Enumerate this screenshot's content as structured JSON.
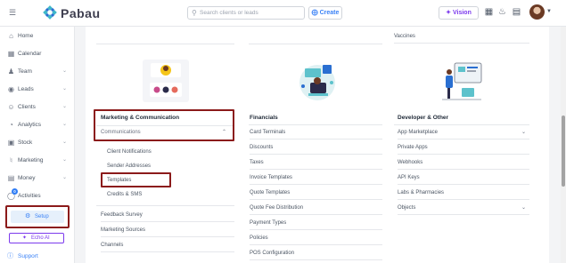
{
  "header": {
    "brand": "Pabau",
    "search_placeholder": "Search clients or leads",
    "create_label": "Create",
    "vision_label": "Vision"
  },
  "sidebar": {
    "items": [
      {
        "label": "Home",
        "icon": "home-icon",
        "caret": false
      },
      {
        "label": "Calendar",
        "icon": "calendar-icon",
        "caret": false
      },
      {
        "label": "Team",
        "icon": "team-icon",
        "caret": true
      },
      {
        "label": "Leads",
        "icon": "leads-icon",
        "caret": true
      },
      {
        "label": "Clients",
        "icon": "clients-icon",
        "caret": true
      },
      {
        "label": "Analytics",
        "icon": "analytics-icon",
        "caret": true
      },
      {
        "label": "Stock",
        "icon": "stock-icon",
        "caret": true
      },
      {
        "label": "Marketing",
        "icon": "marketing-icon",
        "caret": true
      },
      {
        "label": "Money",
        "icon": "money-icon",
        "caret": true
      },
      {
        "label": "Activities",
        "icon": "activities-icon",
        "caret": false,
        "badge": "0"
      }
    ],
    "setup_label": "Setup",
    "echo_label": "Echo AI",
    "support_label": "Support"
  },
  "columns": {
    "marketing": {
      "title": "Marketing & Communication",
      "accordion": "Communications",
      "sub_items": [
        "Client Notifications",
        "Sender Addresses",
        "Templates",
        "Credits & SMS"
      ],
      "items": [
        "Feedback Survey",
        "Marketing Sources",
        "Channels"
      ]
    },
    "financials": {
      "title": "Financials",
      "items": [
        "Card Terminals",
        "Discounts",
        "Taxes",
        "Invoice Templates",
        "Quote Templates",
        "Quote Fee Distribution",
        "Payment Types",
        "Policies",
        "POS Configuration"
      ]
    },
    "developer": {
      "top_item": "Vaccines",
      "title": "Developer & Other",
      "items": [
        {
          "label": "App Marketplace",
          "caret": true
        },
        {
          "label": "Private Apps",
          "caret": false
        },
        {
          "label": "Webhooks",
          "caret": false
        },
        {
          "label": "API Keys",
          "caret": false
        },
        {
          "label": "Labs & Pharmacies",
          "caret": false
        },
        {
          "label": "Objects",
          "caret": true
        }
      ]
    }
  },
  "colors": {
    "accent": "#3b82f6",
    "highlight": "#8b1a1a",
    "vision": "#7c3aed"
  }
}
